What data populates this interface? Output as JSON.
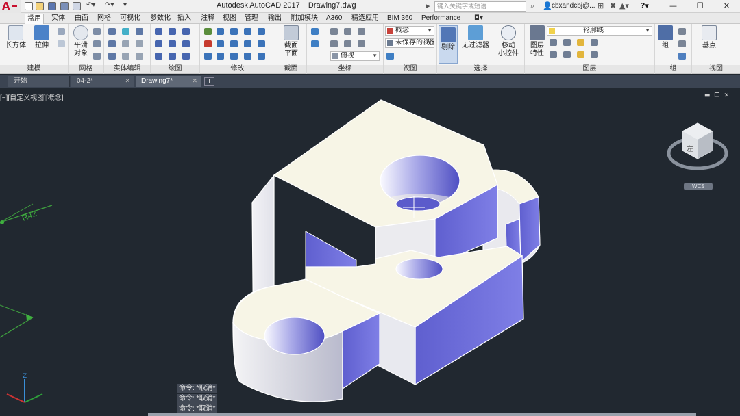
{
  "titlebar": {
    "logo_letter": "A",
    "title": "Autodesk AutoCAD 2017    Drawing7.dwg",
    "search_placeholder": "键入关键字或短语",
    "user": "cbxandcbj@...",
    "help_icon": "question-icon"
  },
  "ribbon_tabs": [
    "常用",
    "实体",
    "曲面",
    "网格",
    "可视化",
    "参数化",
    "插入",
    "注释",
    "视图",
    "管理",
    "输出",
    "附加模块",
    "A360",
    "精选应用",
    "BIM 360",
    "Performance"
  ],
  "ribbon": {
    "box_label": "长方体",
    "extrude_label": "拉伸",
    "smooth_label": "平滑\n对象",
    "section_plane_label": "截面\n平面",
    "nofilter_label": "无过滤器",
    "move_gizmo_label": "移动\n小控件",
    "layer_props_label": "图层\n特性",
    "group_label": "组",
    "base_point_label": "基点",
    "cull_label": "剔除",
    "visual_style": "概念",
    "view_name": "未保存的视图",
    "coord_view": "俯视",
    "layer_name": "轮廓线",
    "panels": [
      "建模",
      "网格",
      "实体编辑",
      "绘图",
      "修改",
      "截面",
      "坐标",
      "视图",
      "选择",
      "图层",
      "组",
      "视图"
    ]
  },
  "file_tabs": [
    {
      "label": "开始"
    },
    {
      "label": "04-2*"
    },
    {
      "label": "Drawing7*"
    }
  ],
  "viewport": {
    "label": "[−][自定义视图][概念]",
    "dim_text": "R42",
    "viewcube_face": "左",
    "viewcube_dropdown": "WCS",
    "ucs_z": "Z",
    "command_lines": [
      "命令: *取消*",
      "命令: *取消*",
      "命令: *取消*"
    ]
  },
  "colors": {
    "background": "#212830",
    "model_top": "#f6f4e4",
    "model_blue": "#6a6ad6",
    "model_grey": "#dfe0e6"
  }
}
